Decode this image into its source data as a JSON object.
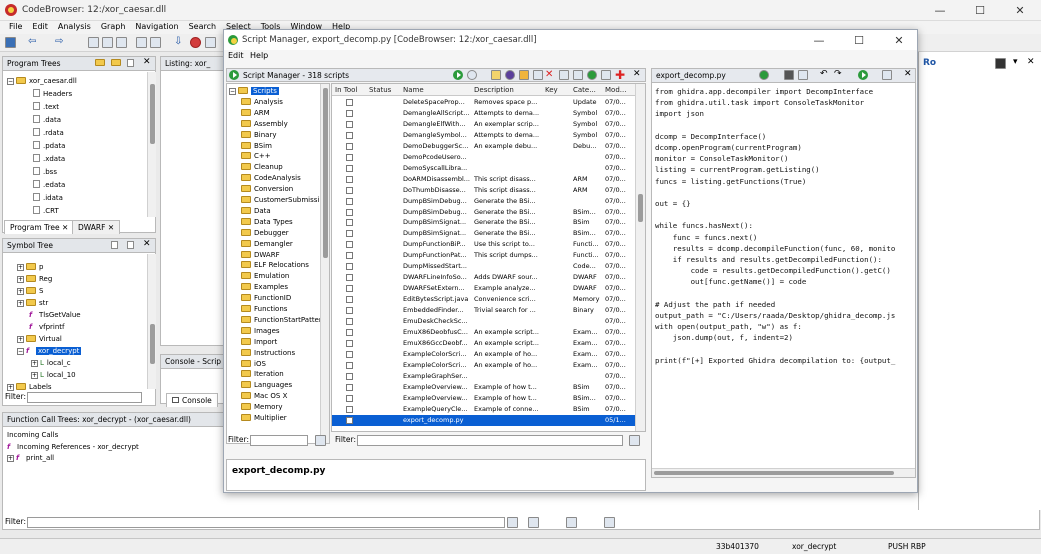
{
  "main_window": {
    "title": "CodeBrowser: 12:/xor_caesar.dll",
    "menu": [
      "File",
      "Edit",
      "Analysis",
      "Graph",
      "Navigation",
      "Search",
      "Select",
      "Tools",
      "Window",
      "Help"
    ],
    "controls": {
      "minimize": "—",
      "maximize": "☐",
      "close": "✕"
    }
  },
  "program_trees": {
    "title": "Program Trees",
    "root": "xor_caesar.dll",
    "items": [
      "Headers",
      ".text",
      ".data",
      ".rdata",
      ".pdata",
      ".xdata",
      ".bss",
      ".edata",
      ".idata",
      ".CRT"
    ],
    "tabs": [
      "Program Tree",
      "DWARF"
    ]
  },
  "listing_tab": "Listing: xor_",
  "symbol_tree": {
    "title": "Symbol Tree",
    "items": [
      "p",
      "Reg",
      "S",
      "str",
      "TlsGetValue",
      "vfprintf",
      "Virtual",
      "xor_decrypt",
      "local_c",
      "local_10",
      "Labels"
    ],
    "filter_label": "Filter:"
  },
  "console": {
    "title": "Console - Scrip",
    "tab": "Console"
  },
  "function_call_trees": {
    "title": "Function Call Trees: xor_decrypt - (xor_caesar.dll)",
    "incoming_label": "Incoming Calls",
    "items": [
      "Incoming References - xor_decrypt",
      "print_all"
    ],
    "filter_label": "Filter:"
  },
  "listing_right": {
    "label": "Ro"
  },
  "status_bar": {
    "address": "33b401370",
    "function": "xor_decrypt",
    "instruction": "PUSH RBP"
  },
  "script_manager": {
    "title": "Script Manager, export_decomp.py [CodeBrowser: 12:/xor_caesar.dll]",
    "menu": [
      "Edit",
      "Help"
    ],
    "panel_title": "Script Manager - 318 scripts",
    "categories": [
      "Scripts",
      "Analysis",
      "ARM",
      "Assembly",
      "Binary",
      "BSim",
      "C++",
      "Cleanup",
      "CodeAnalysis",
      "Conversion",
      "CustomerSubmissi",
      "Data",
      "Data Types",
      "Debugger",
      "Demangler",
      "DWARF",
      "ELF Relocations",
      "Emulation",
      "Examples",
      "FunctionID",
      "Functions",
      "FunctionStartPatter",
      "Images",
      "Import",
      "Instructions",
      "iOS",
      "Iteration",
      "Languages",
      "Mac OS X",
      "Memory",
      "Multiplier"
    ],
    "columns": [
      "In Tool",
      "Status",
      "Name",
      "Description",
      "Key",
      "Cate...",
      "Mod..."
    ],
    "rows": [
      {
        "name": "DeleteSpaceProp...",
        "desc": "Removes space p...",
        "cat": "Update",
        "mod": "07/0..."
      },
      {
        "name": "DemangleAllScript...",
        "desc": "Attempts to dema...",
        "cat": "Symbol",
        "mod": "07/0..."
      },
      {
        "name": "DemangleElfWith...",
        "desc": "An exemplar scrip...",
        "cat": "Symbol",
        "mod": "07/0..."
      },
      {
        "name": "DemangleSymbol...",
        "desc": "Attempts to dema...",
        "cat": "Symbol",
        "mod": "07/0..."
      },
      {
        "name": "DemoDebuggerSc...",
        "desc": "An example debu...",
        "cat": "Debu...",
        "mod": "07/0..."
      },
      {
        "name": "DemoPcodeUsero...",
        "desc": "",
        "cat": "",
        "mod": "07/0..."
      },
      {
        "name": "DemoSyscallLibra...",
        "desc": "",
        "cat": "",
        "mod": "07/0..."
      },
      {
        "name": "DoARMDisassembl...",
        "desc": "This script disass...",
        "cat": "ARM",
        "mod": "07/0..."
      },
      {
        "name": "DoThumbDisasse...",
        "desc": "This script disass...",
        "cat": "ARM",
        "mod": "07/0..."
      },
      {
        "name": "DumpBSimDebug...",
        "desc": "Generate the BSi...",
        "cat": "",
        "mod": "07/0..."
      },
      {
        "name": "DumpBSimDebug...",
        "desc": "Generate the BSi...",
        "cat": "BSim...",
        "mod": "07/0..."
      },
      {
        "name": "DumpBSimSignat...",
        "desc": "Generate the BSi...",
        "cat": "BSim",
        "mod": "07/0..."
      },
      {
        "name": "DumpBSimSignat...",
        "desc": "Generate the BSi...",
        "cat": "BSim...",
        "mod": "07/0..."
      },
      {
        "name": "DumpFunctionBiP...",
        "desc": "Use this script to...",
        "cat": "Functi...",
        "mod": "07/0..."
      },
      {
        "name": "DumpFunctionPat...",
        "desc": "This script dumps...",
        "cat": "Functi...",
        "mod": "07/0..."
      },
      {
        "name": "DumpMissedStart...",
        "desc": "",
        "cat": "Code...",
        "mod": "07/0..."
      },
      {
        "name": "DWARFLineInfoSo...",
        "desc": "Adds DWARF sour...",
        "cat": "DWARF",
        "mod": "07/0..."
      },
      {
        "name": "DWARFSetExtern...",
        "desc": "Example analyze...",
        "cat": "DWARF",
        "mod": "07/0..."
      },
      {
        "name": "EditBytesScript.java",
        "desc": "Convenience scri...",
        "cat": "Memory",
        "mod": "07/0..."
      },
      {
        "name": "EmbeddedFinder...",
        "desc": "Trivial search for ...",
        "cat": "Binary",
        "mod": "07/0..."
      },
      {
        "name": "EmuDeskCheckSc...",
        "desc": "",
        "cat": "",
        "mod": "07/0..."
      },
      {
        "name": "EmuX86DeobfusC...",
        "desc": "An example script...",
        "cat": "Exam...",
        "mod": "07/0..."
      },
      {
        "name": "EmuX86GccDeobf...",
        "desc": "An example script...",
        "cat": "Exam...",
        "mod": "07/0..."
      },
      {
        "name": "ExampleColorScri...",
        "desc": "An example of ho...",
        "cat": "Exam...",
        "mod": "07/0..."
      },
      {
        "name": "ExampleColorScri...",
        "desc": "An example of ho...",
        "cat": "Exam...",
        "mod": "07/0..."
      },
      {
        "name": "ExampleGraphSer...",
        "desc": "",
        "cat": "",
        "mod": "07/0..."
      },
      {
        "name": "ExampleOverview...",
        "desc": "Example of how t...",
        "cat": "BSim",
        "mod": "07/0..."
      },
      {
        "name": "ExampleOverview...",
        "desc": "Example of how t...",
        "cat": "BSim...",
        "mod": "07/0..."
      },
      {
        "name": "ExampleQueryCle...",
        "desc": "Example of conne...",
        "cat": "BSim",
        "mod": "07/0..."
      },
      {
        "name": "export_decomp.py",
        "desc": "",
        "cat": "",
        "mod": "05/1..."
      }
    ],
    "filter_label": "Filter:",
    "selected_script": "export_decomp.py"
  },
  "editor": {
    "title": "export_decomp.py",
    "code": [
      "from ghidra.app.decompiler import DecompInterface",
      "from ghidra.util.task import ConsoleTaskMonitor",
      "import json",
      "",
      "dcomp = DecompInterface()",
      "dcomp.openProgram(currentProgram)",
      "monitor = ConsoleTaskMonitor()",
      "listing = currentProgram.getListing()",
      "funcs = listing.getFunctions(True)",
      "",
      "out = {}",
      "",
      "while funcs.hasNext():",
      "    func = funcs.next()",
      "    results = dcomp.decompileFunction(func, 60, monito",
      "    if results and results.getDecompiledFunction():",
      "        code = results.getDecompiledFunction().getC()",
      "        out[func.getName()] = code",
      "",
      "# Adjust the path if needed",
      "output_path = \"C:/Users/raada/Desktop/ghidra_decomp.js",
      "with open(output_path, \"w\") as f:",
      "    json.dump(out, f, indent=2)",
      "",
      "print(f\"[+] Exported Ghidra decompilation to: {output_"
    ]
  }
}
